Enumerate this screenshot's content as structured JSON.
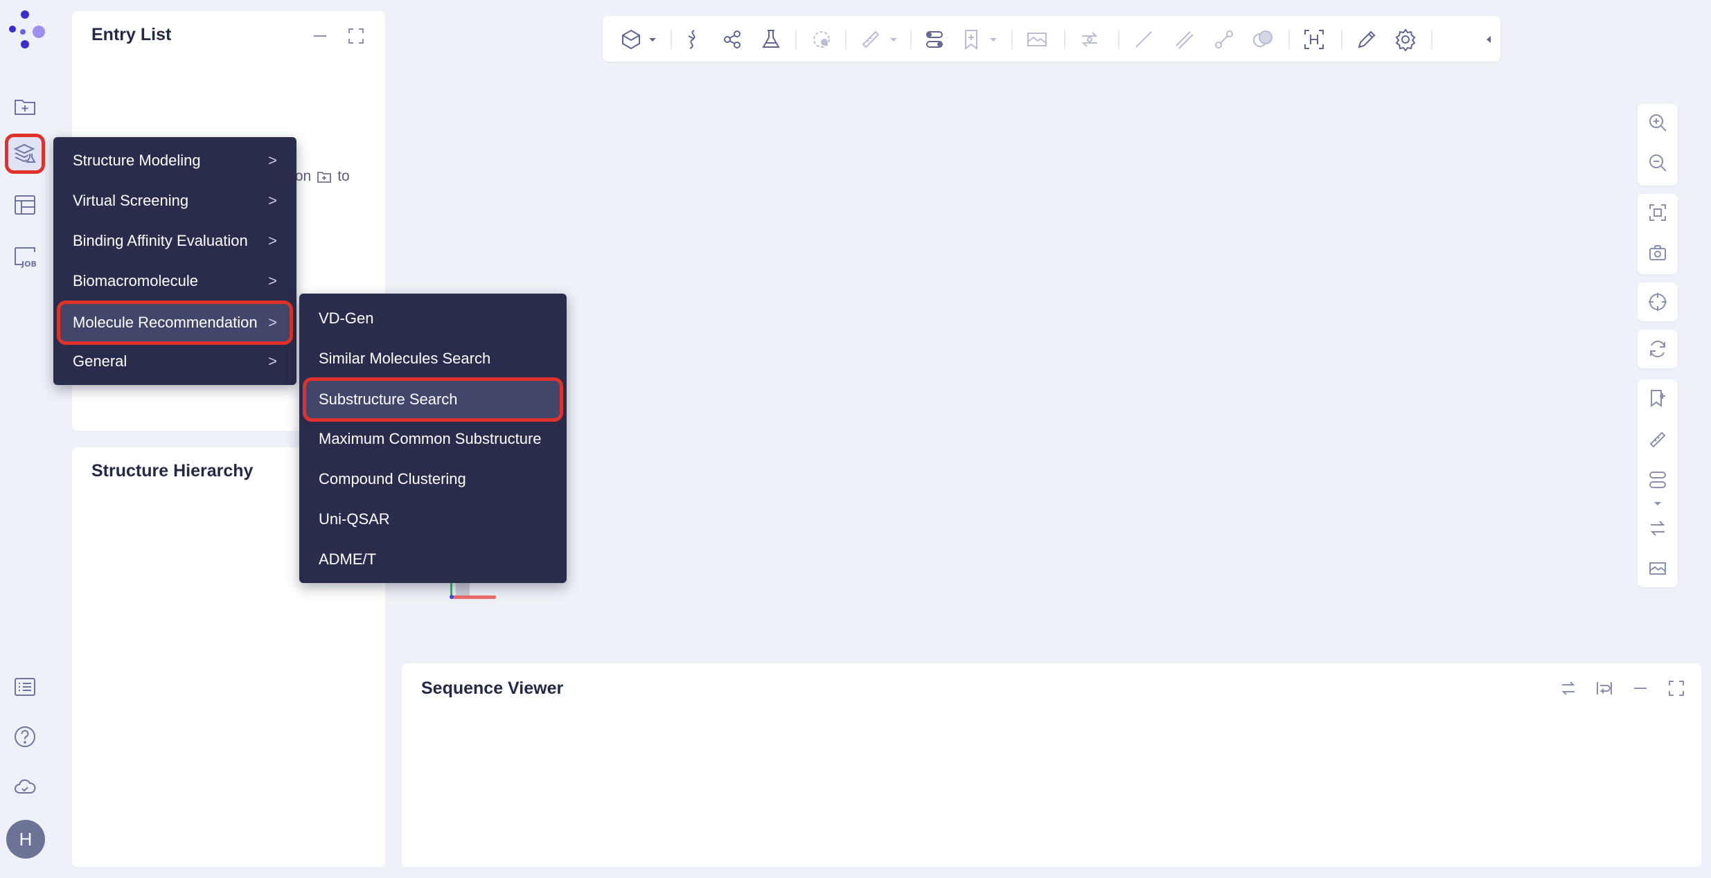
{
  "rail": {
    "items": [
      "new-entry",
      "tools",
      "table",
      "job",
      "list",
      "help",
      "cloud"
    ],
    "avatar_letter": "H"
  },
  "entry_list": {
    "title": "Entry List",
    "hint_fragment": "ton",
    "hint_suffix": "to"
  },
  "structure_hierarchy": {
    "title": "Structure Hierarchy"
  },
  "sequence_viewer": {
    "title": "Sequence Viewer"
  },
  "main_menu": {
    "items": [
      {
        "label": "Structure Modeling",
        "arrow": ">"
      },
      {
        "label": "Virtual Screening",
        "arrow": ">"
      },
      {
        "label": "Binding Affinity Evaluation",
        "arrow": ">"
      },
      {
        "label": "Biomacromolecule",
        "arrow": ">"
      },
      {
        "label": "Molecule Recommendation",
        "arrow": ">"
      },
      {
        "label": "General",
        "arrow": ">"
      }
    ]
  },
  "sub_menu": {
    "items": [
      {
        "label": "VD-Gen"
      },
      {
        "label": "Similar Molecules Search"
      },
      {
        "label": "Substructure Search"
      },
      {
        "label": "Maximum Common Substructure"
      },
      {
        "label": "Compound Clustering"
      },
      {
        "label": "Uni-QSAR"
      },
      {
        "label": "ADME/T"
      }
    ]
  },
  "colors": {
    "accent": "#4b3fd1",
    "highlight_border": "#e0322a",
    "menu_bg": "#2a2c4b",
    "page_bg": "#eff1f8"
  }
}
